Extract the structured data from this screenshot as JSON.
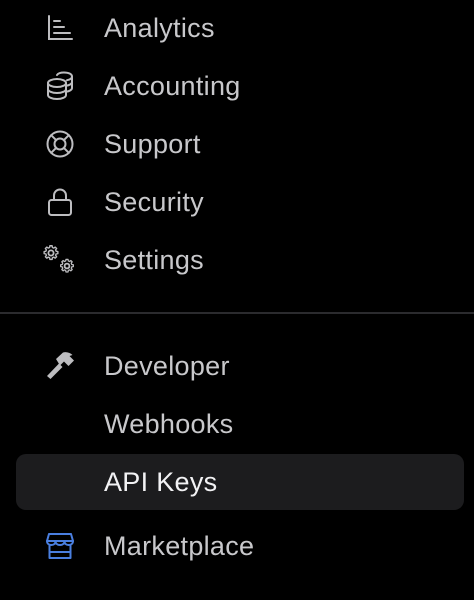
{
  "nav": {
    "group1": [
      {
        "label": "Analytics",
        "icon": "bar-chart-icon"
      },
      {
        "label": "Accounting",
        "icon": "coins-icon"
      },
      {
        "label": "Support",
        "icon": "lifebuoy-icon"
      },
      {
        "label": "Security",
        "icon": "lock-icon"
      },
      {
        "label": "Settings",
        "icon": "gears-icon"
      }
    ],
    "group2": [
      {
        "label": "Developer",
        "icon": "hammer-icon"
      },
      {
        "label": "Webhooks"
      },
      {
        "label": "API Keys",
        "active": true
      },
      {
        "label": "Marketplace",
        "icon": "storefront-icon"
      }
    ]
  },
  "colors": {
    "background": "#000000",
    "text": "#c8c8cb",
    "active_text": "#f2f2f4",
    "active_background": "#1c1c1e",
    "marketplace_icon": "#4a7fe0",
    "divider": "#2b2b2e"
  }
}
